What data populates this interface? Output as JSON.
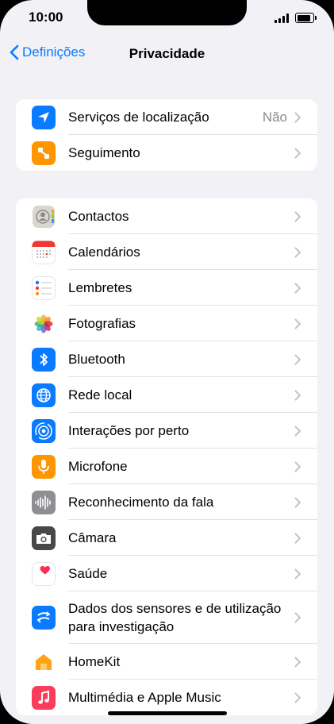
{
  "status": {
    "time": "10:00"
  },
  "nav": {
    "back_label": "Definições",
    "title": "Privacidade"
  },
  "group1": [
    {
      "name": "location-services",
      "label": "Serviços de localização",
      "value": "Não",
      "icon": "location-arrow-icon",
      "color": "#0a7aff"
    },
    {
      "name": "tracking",
      "label": "Seguimento",
      "value": "",
      "icon": "tracking-icon",
      "color": "#ff9500"
    }
  ],
  "group2": [
    {
      "name": "contacts",
      "label": "Contactos",
      "icon": "contacts-icon",
      "color": "#c9c6c0"
    },
    {
      "name": "calendars",
      "label": "Calendários",
      "icon": "calendar-icon",
      "color": "#ffffff"
    },
    {
      "name": "reminders",
      "label": "Lembretes",
      "icon": "reminders-icon",
      "color": "#ffffff"
    },
    {
      "name": "photos",
      "label": "Fotografias",
      "icon": "photos-icon",
      "color": "#ffffff"
    },
    {
      "name": "bluetooth",
      "label": "Bluetooth",
      "icon": "bluetooth-icon",
      "color": "#0a7aff"
    },
    {
      "name": "local-network",
      "label": "Rede local",
      "icon": "globe-icon",
      "color": "#0a7aff"
    },
    {
      "name": "nearby-interactions",
      "label": "Interações por perto",
      "icon": "nearby-icon",
      "color": "#0a7aff"
    },
    {
      "name": "microphone",
      "label": "Microfone",
      "icon": "microphone-icon",
      "color": "#ff9500"
    },
    {
      "name": "speech-recognition",
      "label": "Reconhecimento da fala",
      "icon": "waveform-icon",
      "color": "#8e8e93"
    },
    {
      "name": "camera",
      "label": "Câmara",
      "icon": "camera-icon",
      "color": "#48484a"
    },
    {
      "name": "health",
      "label": "Saúde",
      "icon": "heart-icon",
      "color": "#ffffff"
    },
    {
      "name": "sensor-data",
      "label": "Dados dos sensores e de utilização para investigação",
      "icon": "research-icon",
      "color": "#0a7aff",
      "tall": true
    },
    {
      "name": "homekit",
      "label": "HomeKit",
      "icon": "home-icon",
      "color": "#ffffff"
    },
    {
      "name": "media-music",
      "label": "Multimédia e Apple Music",
      "icon": "music-icon",
      "color": "#fb3c5a"
    }
  ]
}
